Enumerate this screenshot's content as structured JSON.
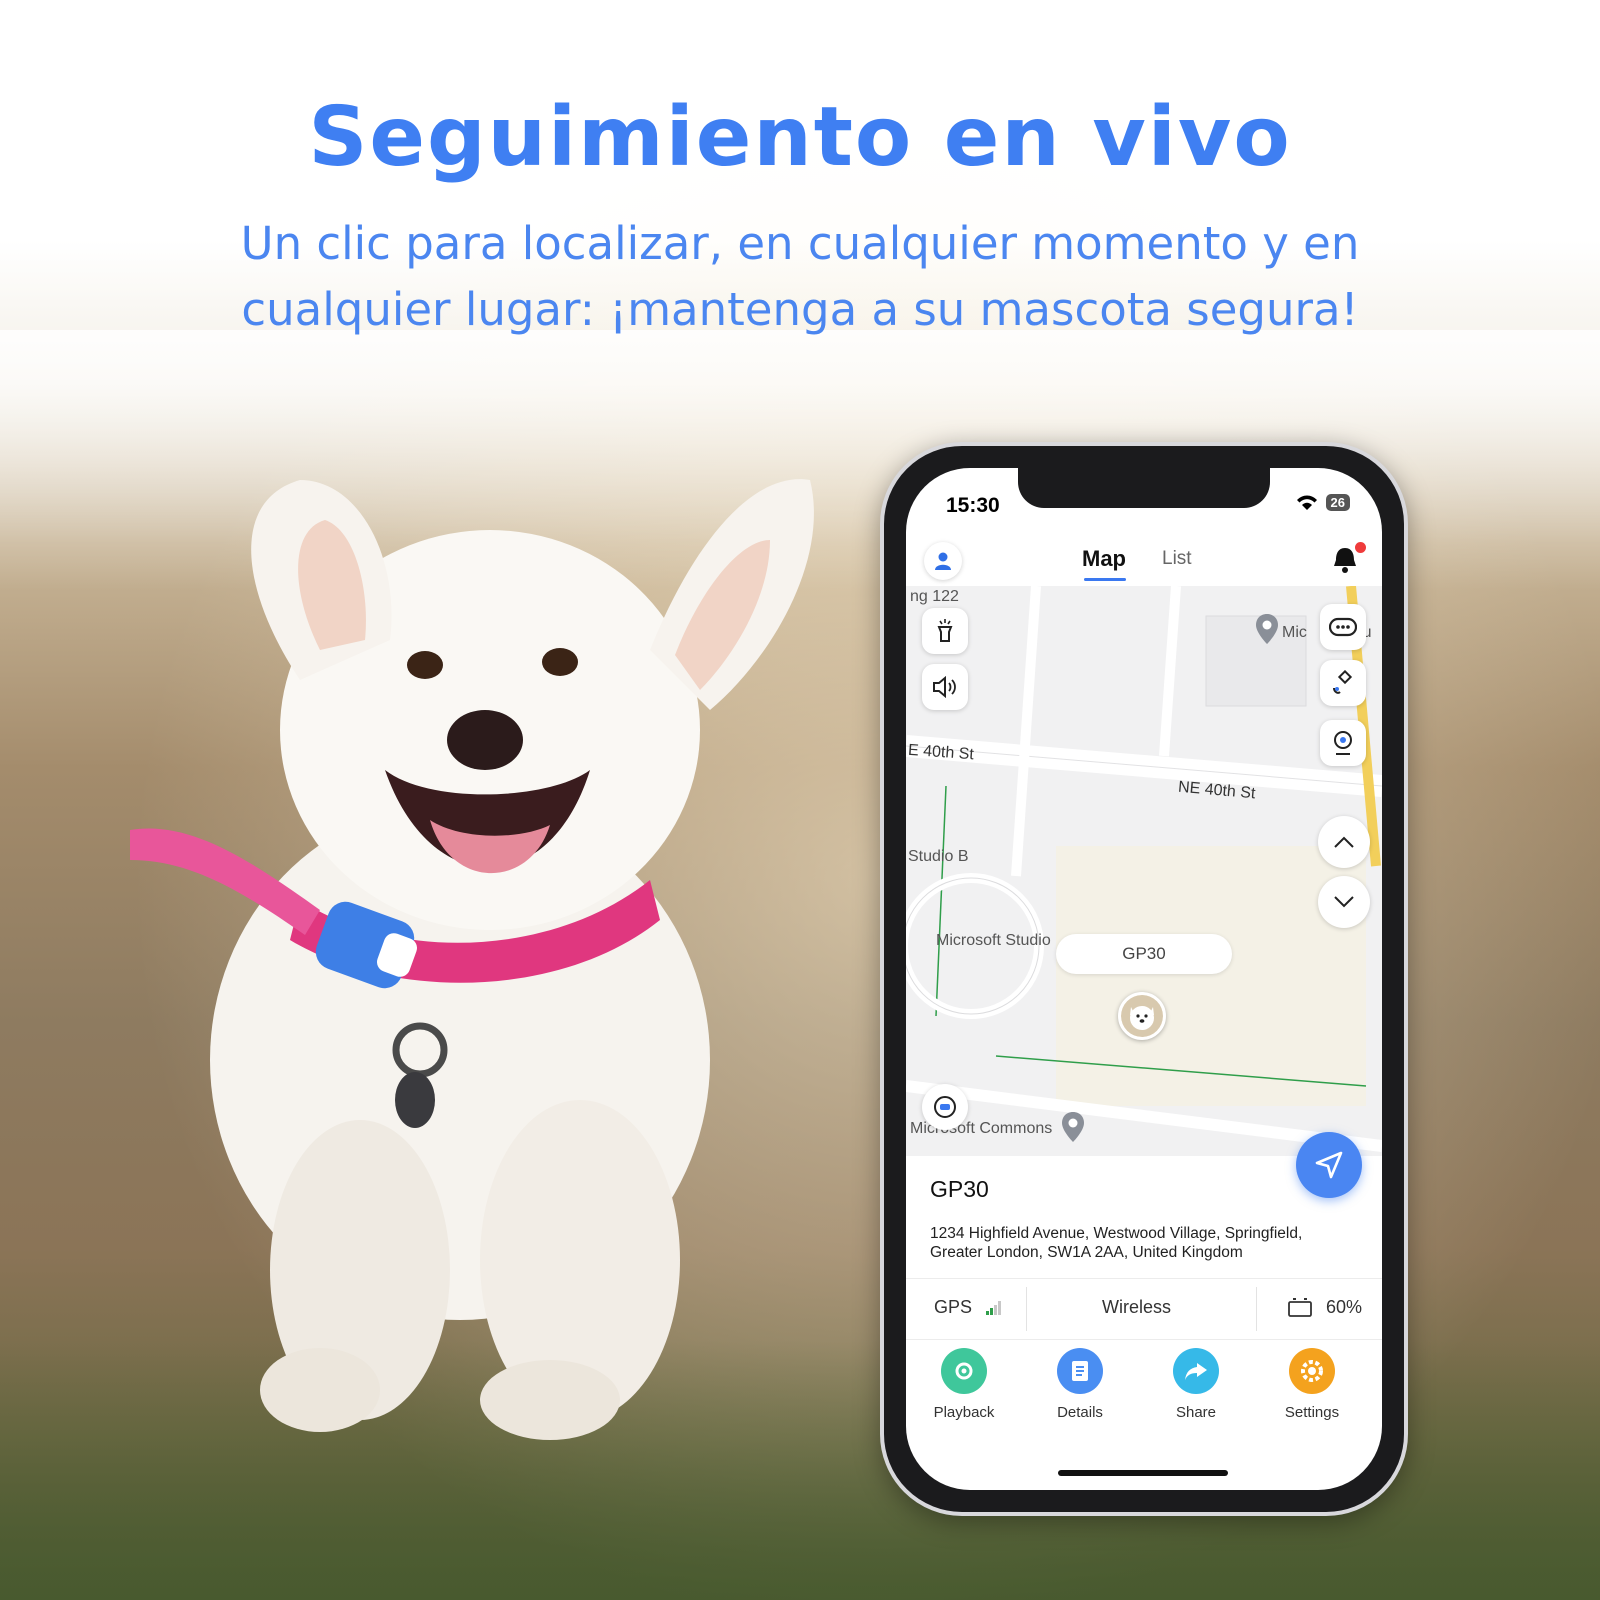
{
  "header": {
    "title": "Seguimiento en vivo",
    "subtitle": "Un clic para localizar, en cualquier momento y en cualquier lugar: ¡mantenga a su mascota segura!"
  },
  "phone": {
    "status_bar": {
      "time": "15:30",
      "battery": "26"
    },
    "nav": {
      "tab_map": "Map",
      "tab_list": "List"
    },
    "map": {
      "labels": {
        "building_122": "ng 122",
        "micro": "Mic",
        "bu": "Bu",
        "street_1": "E 40th St",
        "street_2": "NE 40th St",
        "studio_b": "Studio B",
        "microsoft_studio": "Microsoft Studio",
        "microsoft_commons": "Microsoft Commons"
      },
      "bubble": "GP30"
    },
    "device": {
      "name": "GP30",
      "address": "1234 Highfield Avenue, Westwood Village, Springfield, Greater London, SW1A 2AA, United Kingdom"
    },
    "stats": {
      "gps": "GPS",
      "connection": "Wireless",
      "battery": "60%"
    },
    "actions": [
      {
        "label": "Playback",
        "color": "#3fc79b"
      },
      {
        "label": "Details",
        "color": "#4a8ef2"
      },
      {
        "label": "Share",
        "color": "#36b9e8"
      },
      {
        "label": "Settings",
        "color": "#f4a21e"
      }
    ]
  },
  "colors": {
    "accent": "#3f7ff2",
    "fab": "#4a86f2",
    "alert": "#ef3b3b"
  }
}
